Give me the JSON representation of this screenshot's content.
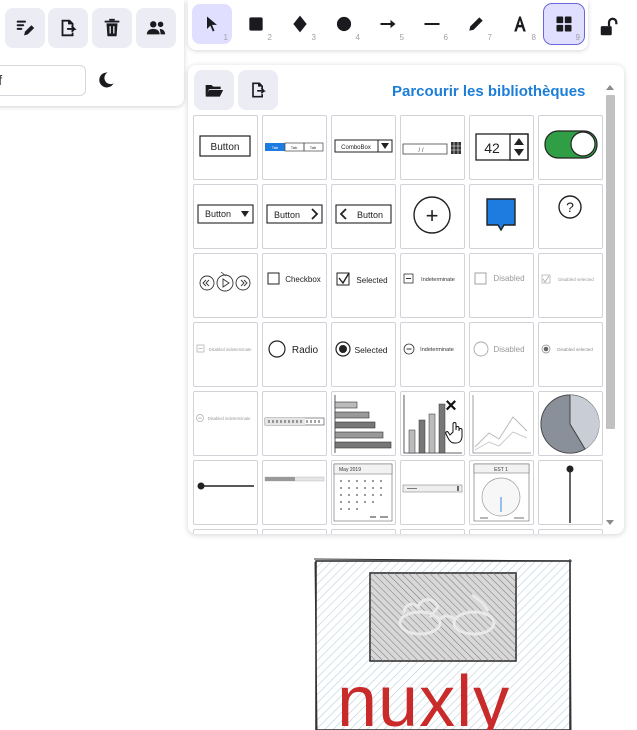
{
  "left_panel": {
    "buttons": [
      {
        "name": "edit-icon"
      },
      {
        "name": "export-icon"
      },
      {
        "name": "trash-icon"
      },
      {
        "name": "collaborators-icon"
      }
    ],
    "canvas_background_value": "fff",
    "theme_toggle_icon": "moon-icon"
  },
  "toolbar": {
    "tools": [
      {
        "icon": "pointer-icon",
        "key": "1"
      },
      {
        "icon": "rectangle-icon",
        "key": "2"
      },
      {
        "icon": "diamond-icon",
        "key": "3"
      },
      {
        "icon": "ellipse-icon",
        "key": "4"
      },
      {
        "icon": "arrow-icon",
        "key": "5"
      },
      {
        "icon": "line-icon",
        "key": "6"
      },
      {
        "icon": "pencil-icon",
        "key": "7"
      },
      {
        "icon": "text-icon",
        "key": "8"
      },
      {
        "icon": "library-icon",
        "key": "9"
      }
    ],
    "lock_icon": "unlock-icon"
  },
  "library": {
    "browse_label": "Parcourir les bibliothèques",
    "items": {
      "button": "Button",
      "tabs": [
        "Tab",
        "Tab",
        "Tab"
      ],
      "combobox": "ComboBox",
      "date": "/ /",
      "stepper_value": "42",
      "button_dropdown": "Button",
      "button_next": "Button",
      "button_back": "Button",
      "plus": "+",
      "help": "?",
      "checkbox": "Checkbox",
      "selected": "Selected",
      "indeterminate": "Indeterminate",
      "disabled": "Disabled",
      "disabled_selected": "Disabled selected",
      "disabled_indeterminate": "Disabled indeterminate",
      "radio": "Radio",
      "radio_selected": "Selected",
      "radio_indeterminate": "Indeterminate",
      "radio_disabled": "Disabled",
      "radio_disabled_selected": "Disabled selected",
      "radio_disabled_indeterminate": "Disabled indeterminate",
      "remove_mark": "×",
      "calendar_title": "May 2019",
      "clock_title": "EST 1"
    }
  },
  "canvas": {
    "logo_text": "nuxly"
  },
  "colors": {
    "accent": "#6965db",
    "browse_link": "#1c7ed6",
    "toggle_green": "#2f9e44",
    "bubble_blue": "#1e7be0",
    "logo_red": "#c92a2a"
  }
}
